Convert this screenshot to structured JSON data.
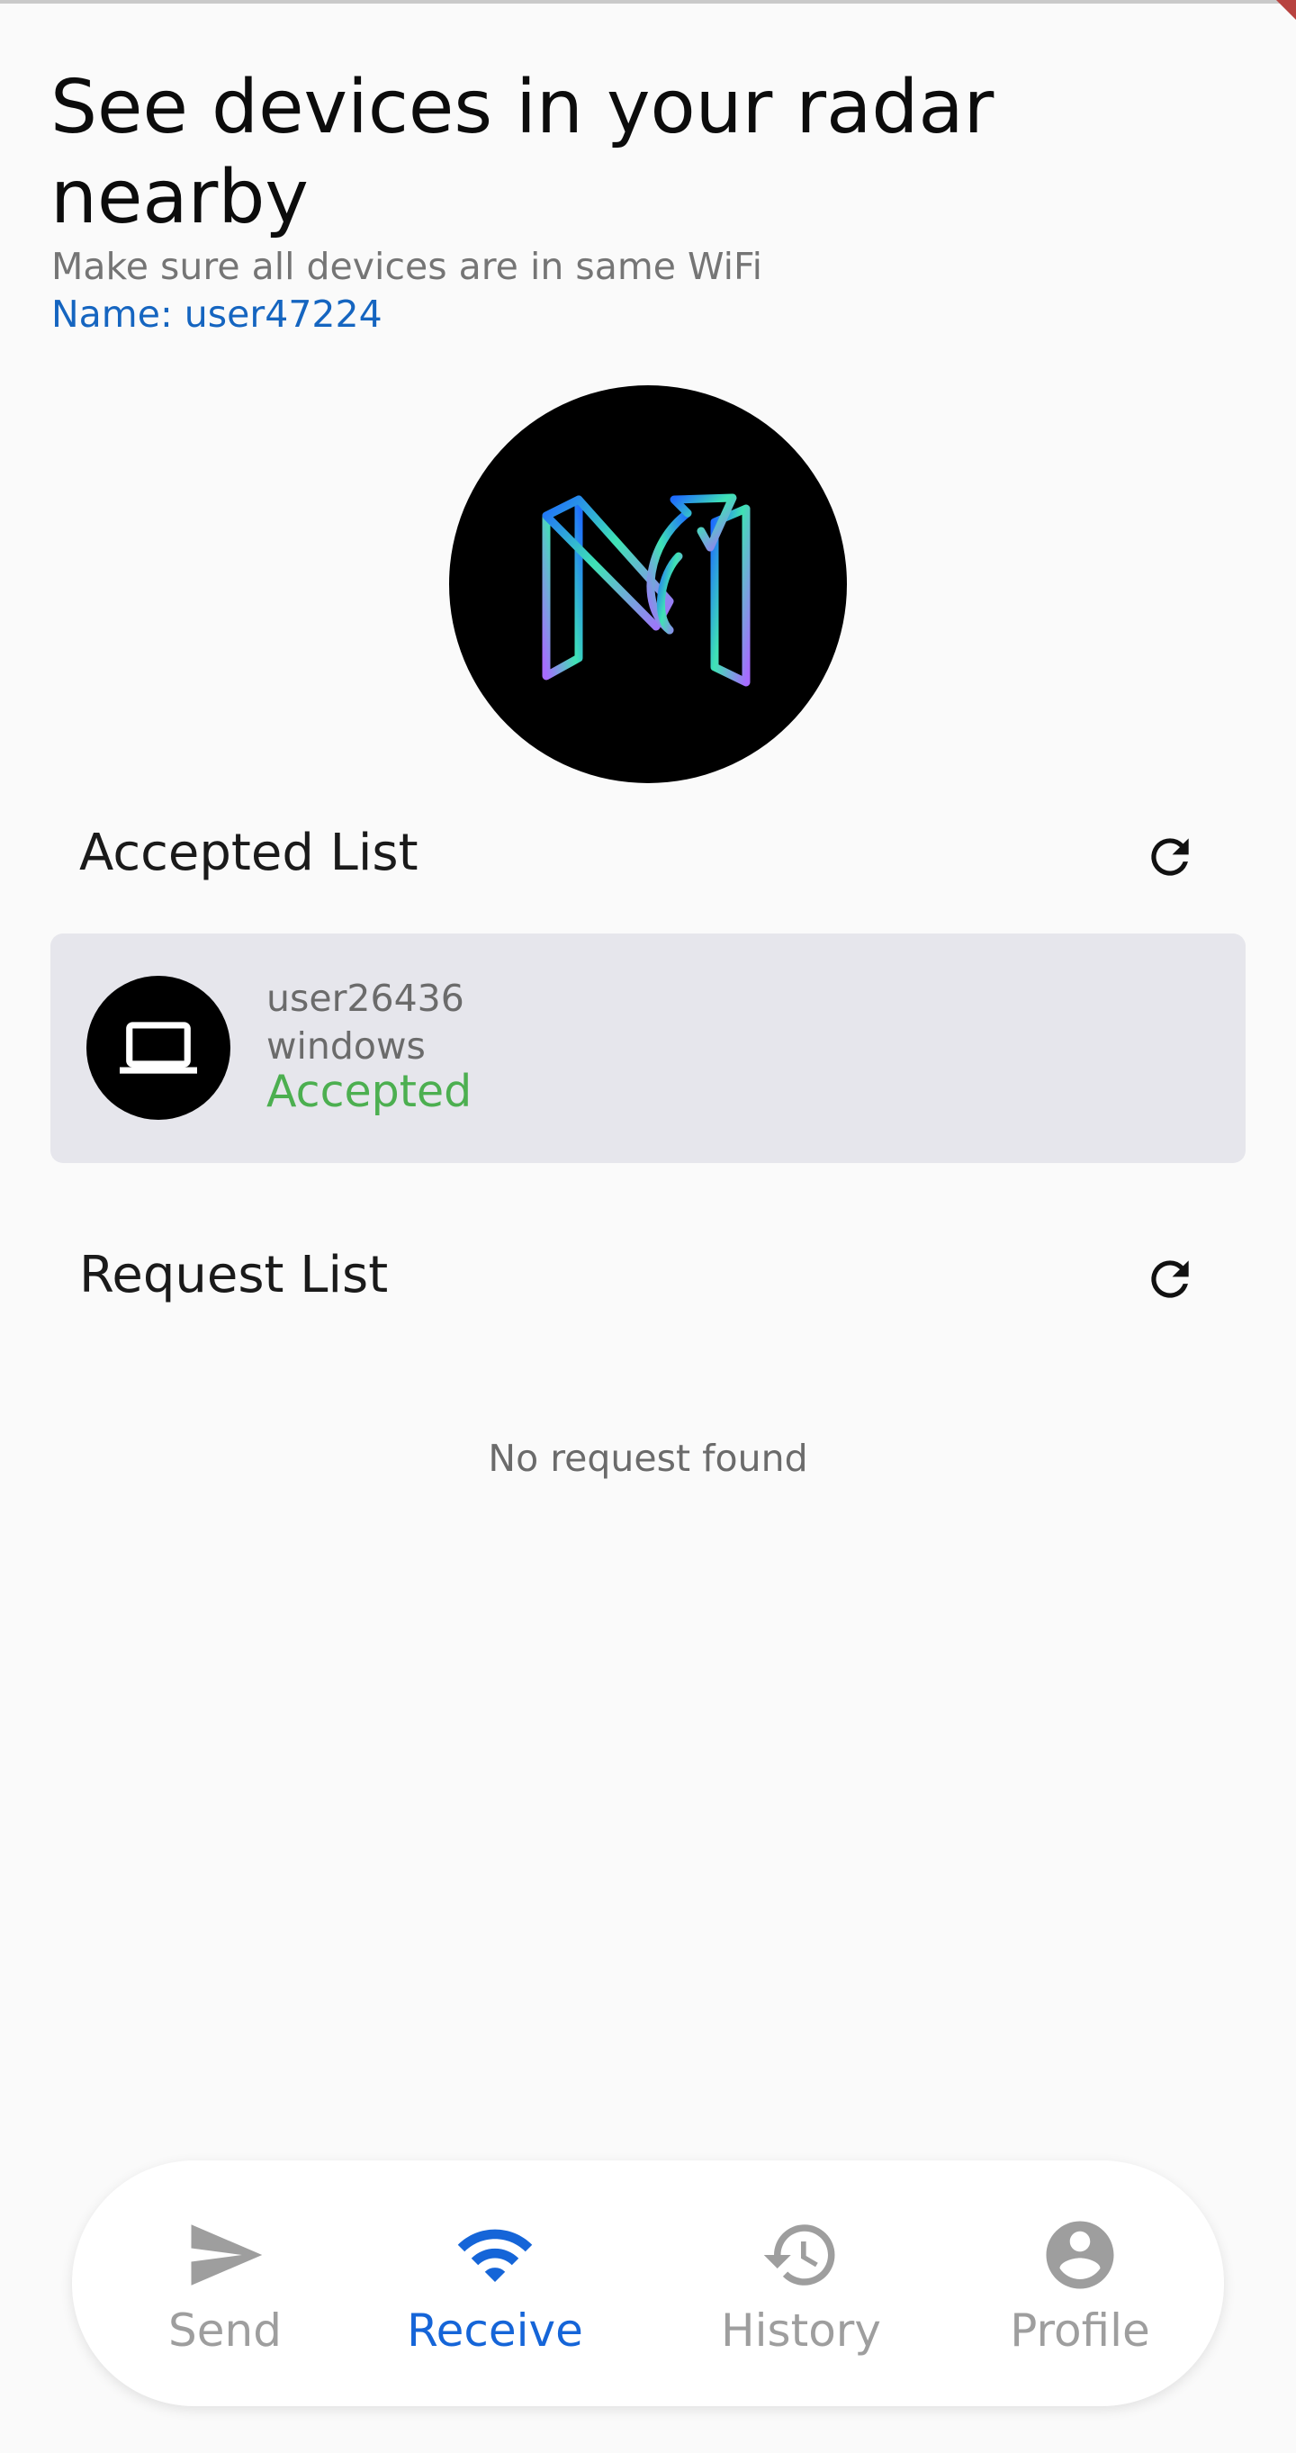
{
  "header": {
    "title": "See devices in your radar nearby",
    "subtitle": "Make sure all devices are in same WiFi",
    "username": "Name: user47224"
  },
  "logo": {
    "icon": "app-logo-m-arrow-icon"
  },
  "accepted_section": {
    "title": "Accepted List",
    "refresh_icon": "refresh-icon",
    "devices": [
      {
        "name": "user26436",
        "os": "windows",
        "status": "Accepted",
        "icon": "laptop-icon"
      }
    ]
  },
  "request_section": {
    "title": "Request List",
    "refresh_icon": "refresh-icon",
    "empty_text": "No request found"
  },
  "bottom_nav": {
    "items": [
      {
        "label": "Send",
        "icon": "send-icon",
        "active": false
      },
      {
        "label": "Receive",
        "icon": "wifi-icon",
        "active": true
      },
      {
        "label": "History",
        "icon": "history-icon",
        "active": false
      },
      {
        "label": "Profile",
        "icon": "profile-icon",
        "active": false
      }
    ]
  },
  "colors": {
    "accent": "#1565c0",
    "active_nav": "#1565d8",
    "inactive_nav": "#9e9e9e",
    "accepted_status": "#4caf50",
    "card_background": "#e6e6ec"
  }
}
